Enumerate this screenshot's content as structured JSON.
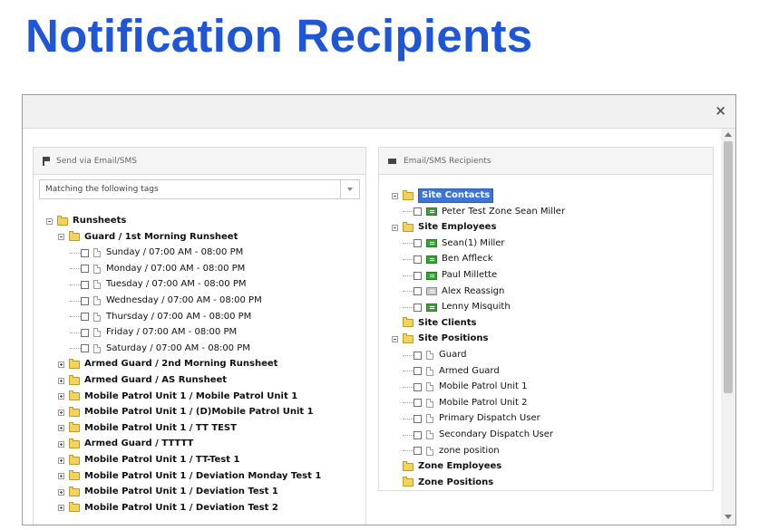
{
  "page": {
    "title": "Notification Recipients"
  },
  "modal": {
    "close_label": "×"
  },
  "left_panel": {
    "header": "Send via Email/SMS",
    "select_value": "Matching the following tags",
    "tree": [
      {
        "label": "Runsheets",
        "bold": true,
        "level": 0,
        "expander": "minus",
        "folder": true
      },
      {
        "label": "Guard / 1st Morning Runsheet",
        "bold": true,
        "level": 1,
        "expander": "minus",
        "folder": true
      },
      {
        "label": "Sunday / 07:00 AM - 08:00 PM",
        "level": 2,
        "checkbox": true,
        "doc": true
      },
      {
        "label": "Monday / 07:00 AM - 08:00 PM",
        "level": 2,
        "checkbox": true,
        "doc": true
      },
      {
        "label": "Tuesday / 07:00 AM - 08:00 PM",
        "level": 2,
        "checkbox": true,
        "doc": true
      },
      {
        "label": "Wednesday / 07:00 AM - 08:00 PM",
        "level": 2,
        "checkbox": true,
        "doc": true
      },
      {
        "label": "Thursday / 07:00 AM - 08:00 PM",
        "level": 2,
        "checkbox": true,
        "doc": true
      },
      {
        "label": "Friday / 07:00 AM - 08:00 PM",
        "level": 2,
        "checkbox": true,
        "doc": true
      },
      {
        "label": "Saturday / 07:00 AM - 08:00 PM",
        "level": 2,
        "checkbox": true,
        "doc": true
      },
      {
        "label": "Armed Guard / 2nd Morning Runsheet",
        "bold": true,
        "level": 1,
        "expander": "plus",
        "folder": true
      },
      {
        "label": "Armed Guard / AS Runsheet",
        "bold": true,
        "level": 1,
        "expander": "plus",
        "folder": true
      },
      {
        "label": "Mobile Patrol Unit 1 / Mobile Patrol Unit 1",
        "bold": true,
        "level": 1,
        "expander": "plus",
        "folder": true
      },
      {
        "label": "Mobile Patrol Unit 1 / (D)Mobile Patrol Unit 1",
        "bold": true,
        "level": 1,
        "expander": "plus",
        "folder": true
      },
      {
        "label": "Mobile Patrol Unit 1 / TT TEST",
        "bold": true,
        "level": 1,
        "expander": "plus",
        "folder": true
      },
      {
        "label": "Armed Guard / TTTTT",
        "bold": true,
        "level": 1,
        "expander": "plus",
        "folder": true
      },
      {
        "label": "Mobile Patrol Unit 1 / TT-Test 1",
        "bold": true,
        "level": 1,
        "expander": "plus",
        "folder": true
      },
      {
        "label": "Mobile Patrol Unit 1 / Deviation Monday Test 1",
        "bold": true,
        "level": 1,
        "expander": "plus",
        "folder": true
      },
      {
        "label": "Mobile Patrol Unit 1 / Deviation Test 1",
        "bold": true,
        "level": 1,
        "expander": "plus",
        "folder": true
      },
      {
        "label": "Mobile Patrol Unit 1 / Deviation Test 2",
        "bold": true,
        "level": 1,
        "expander": "plus",
        "folder": true
      }
    ]
  },
  "right_panel": {
    "header": "Email/SMS Recipients",
    "tree": [
      {
        "label": "Site Contacts",
        "bold": true,
        "level": 0,
        "expander": "minus",
        "folder": true,
        "selected": true
      },
      {
        "label": "Peter Test Zone Sean Miller",
        "level": 1,
        "checkbox": true,
        "person": "green"
      },
      {
        "label": "Site Employees",
        "bold": true,
        "level": 0,
        "expander": "minus",
        "folder": true
      },
      {
        "label": "Sean(1) Miller",
        "level": 1,
        "checkbox": true,
        "person": "green"
      },
      {
        "label": "Ben Affleck",
        "level": 1,
        "checkbox": true,
        "person": "green"
      },
      {
        "label": "Paul Millette",
        "level": 1,
        "checkbox": true,
        "person": "green"
      },
      {
        "label": "Alex Reassign",
        "level": 1,
        "checkbox": true,
        "person": "gray"
      },
      {
        "label": "Lenny Misquith",
        "level": 1,
        "checkbox": true,
        "person": "green"
      },
      {
        "label": "Site Clients",
        "bold": true,
        "level": 0,
        "expander": "none",
        "folder": true
      },
      {
        "label": "Site Positions",
        "bold": true,
        "level": 0,
        "expander": "minus",
        "folder": true
      },
      {
        "label": "Guard",
        "level": 1,
        "checkbox": true,
        "doc": true
      },
      {
        "label": "Armed Guard",
        "level": 1,
        "checkbox": true,
        "doc": true
      },
      {
        "label": "Mobile Patrol Unit 1",
        "level": 1,
        "checkbox": true,
        "doc": true
      },
      {
        "label": "Mobile Patrol Unit 2",
        "level": 1,
        "checkbox": true,
        "doc": true
      },
      {
        "label": "Primary Dispatch User",
        "level": 1,
        "checkbox": true,
        "doc": true
      },
      {
        "label": "Secondary Dispatch User",
        "level": 1,
        "checkbox": true,
        "doc": true
      },
      {
        "label": "zone position",
        "level": 1,
        "checkbox": true,
        "doc": true
      },
      {
        "label": "Zone Employees",
        "bold": true,
        "level": 0,
        "expander": "none",
        "folder": true
      },
      {
        "label": "Zone Positions",
        "bold": true,
        "level": 0,
        "expander": "none",
        "folder": true
      }
    ]
  }
}
